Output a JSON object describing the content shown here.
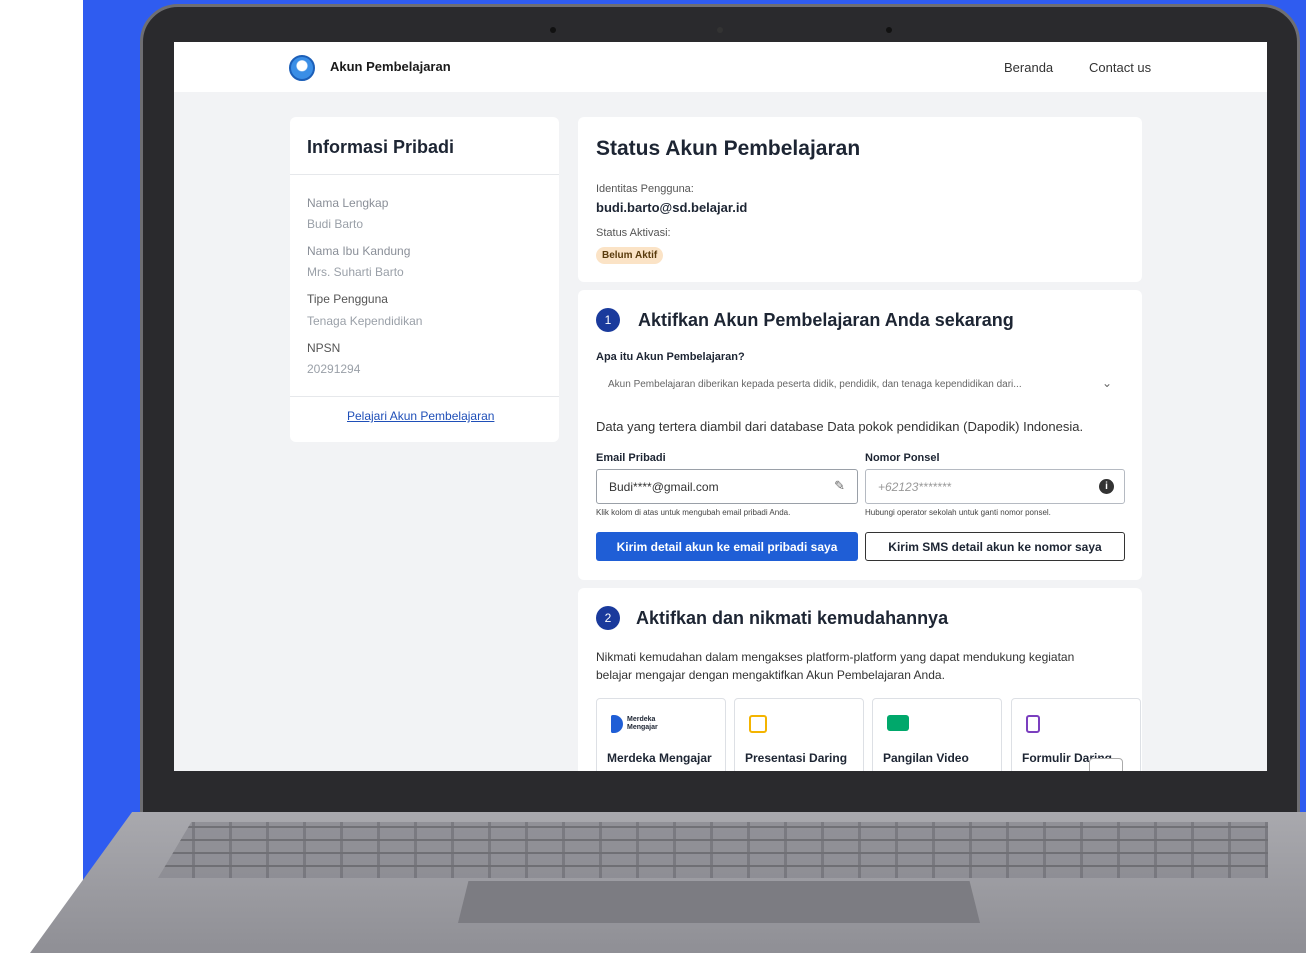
{
  "header": {
    "brand": "Akun Pembelajaran",
    "nav": [
      "Beranda",
      "Contact us"
    ]
  },
  "info": {
    "title": "Informasi Pribadi",
    "fields": [
      {
        "label": "Nama Lengkap",
        "value": "Budi Barto"
      },
      {
        "label": "Nama Ibu Kandung",
        "value": "Mrs. Suharti Barto"
      },
      {
        "label": "Tipe Pengguna",
        "value": "Tenaga Kependidikan"
      },
      {
        "label": "NPSN",
        "value": "20291294"
      }
    ],
    "link": "Pelajari Akun Pembelajaran"
  },
  "status": {
    "title": "Status Akun Pembelajaran",
    "identity_label": "Identitas Pengguna:",
    "identity_value": "budi.barto@sd.belajar.id",
    "activation_label": "Status Aktivasi:",
    "activation_badge": "Belum Aktif"
  },
  "step1": {
    "number": "1",
    "title": "Aktifkan Akun Pembelajaran Anda sekarang",
    "faq_question": "Apa itu Akun Pembelajaran?",
    "faq_answer": "Akun Pembelajaran diberikan kepada peserta didik, pendidik, dan tenaga kependidikan dari...",
    "source_note": "Data yang tertera diambil dari database Data pokok pendidikan (Dapodik) Indonesia.",
    "email_label": "Email Pribadi",
    "email_value": "Budi****@gmail.com",
    "email_help": "Klik kolom di atas untuk mengubah email pribadi Anda.",
    "phone_label": "Nomor Ponsel",
    "phone_value": "+62123*******",
    "phone_help": "Hubungi operator sekolah untuk ganti nomor ponsel.",
    "email_button": "Kirim detail akun ke email pribadi saya",
    "sms_button": "Kirim SMS detail akun ke nomor saya"
  },
  "step2": {
    "number": "2",
    "title": "Aktifkan dan nikmati kemudahannya",
    "description_line1": "Nikmati kemudahan dalam mengakses platform-platform yang dapat mendukung kegiatan",
    "description_line2": "belajar mengajar dengan mengaktifkan Akun Pembelajaran Anda.",
    "tiles": [
      {
        "name": "Merdeka Mengajar",
        "logo_text_1": "Merdeka",
        "logo_text_2": "Mengajar",
        "icon": "merdeka-mengajar-logo",
        "color": "#1f5ed6"
      },
      {
        "name": "Presentasi Daring",
        "icon": "slides-icon",
        "color": "#f4b400"
      },
      {
        "name": "Pangilan Video",
        "icon": "video-call-icon",
        "color": "#00a86b"
      },
      {
        "name": "Formulir Daring",
        "icon": "forms-icon",
        "color": "#7b3fbf"
      }
    ]
  }
}
